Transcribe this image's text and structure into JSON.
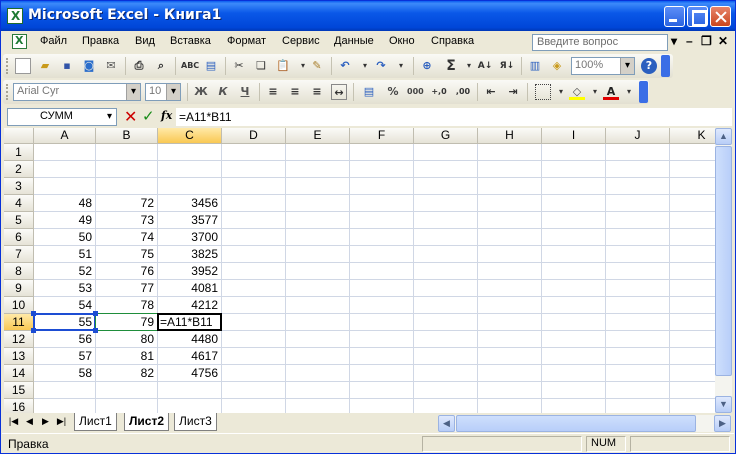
{
  "window": {
    "title": "Microsoft Excel - Книга1"
  },
  "menu": {
    "items": [
      "Файл",
      "Правка",
      "Вид",
      "Вставка",
      "Формат",
      "Сервис",
      "Данные",
      "Окно",
      "Справка"
    ],
    "help_placeholder": "Введите вопрос"
  },
  "toolbar": {
    "zoom": "100%",
    "font_name": "Arial Cyr",
    "font_size": "10",
    "bold_label": "Ж",
    "italic_label": "К",
    "underline_label": "Ч",
    "percent_label": "%",
    "thousands_label": "000"
  },
  "formula_bar": {
    "name_box": "СУММ",
    "formula": "=A11*B11"
  },
  "grid": {
    "columns": [
      "A",
      "B",
      "C",
      "D",
      "E",
      "F",
      "G",
      "H",
      "I",
      "J",
      "K"
    ],
    "rows": [
      "1",
      "2",
      "3",
      "4",
      "5",
      "6",
      "7",
      "8",
      "9",
      "10",
      "11",
      "12",
      "13",
      "14",
      "15",
      "16"
    ],
    "data": [
      {
        "row": 4,
        "a": "48",
        "b": "72",
        "c": "3456"
      },
      {
        "row": 5,
        "a": "49",
        "b": "73",
        "c": "3577"
      },
      {
        "row": 6,
        "a": "50",
        "b": "74",
        "c": "3700"
      },
      {
        "row": 7,
        "a": "51",
        "b": "75",
        "c": "3825"
      },
      {
        "row": 8,
        "a": "52",
        "b": "76",
        "c": "3952"
      },
      {
        "row": 9,
        "a": "53",
        "b": "77",
        "c": "4081"
      },
      {
        "row": 10,
        "a": "54",
        "b": "78",
        "c": "4212"
      },
      {
        "row": 11,
        "a": "55",
        "b": "79",
        "c": "=A11*B11"
      },
      {
        "row": 12,
        "a": "56",
        "b": "80",
        "c": "4480"
      },
      {
        "row": 13,
        "a": "57",
        "b": "81",
        "c": "4617"
      },
      {
        "row": 14,
        "a": "58",
        "b": "82",
        "c": "4756"
      }
    ],
    "selected_column": "C",
    "selected_row": "11"
  },
  "sheets": [
    "Лист1",
    "Лист2",
    "Лист3"
  ],
  "active_sheet": "Лист2",
  "status": {
    "mode": "Правка",
    "num": "NUM"
  },
  "colors": {
    "title_bar": "#0a58e8",
    "selection": "#1d4dd3",
    "reference": "#1f8e3b"
  }
}
